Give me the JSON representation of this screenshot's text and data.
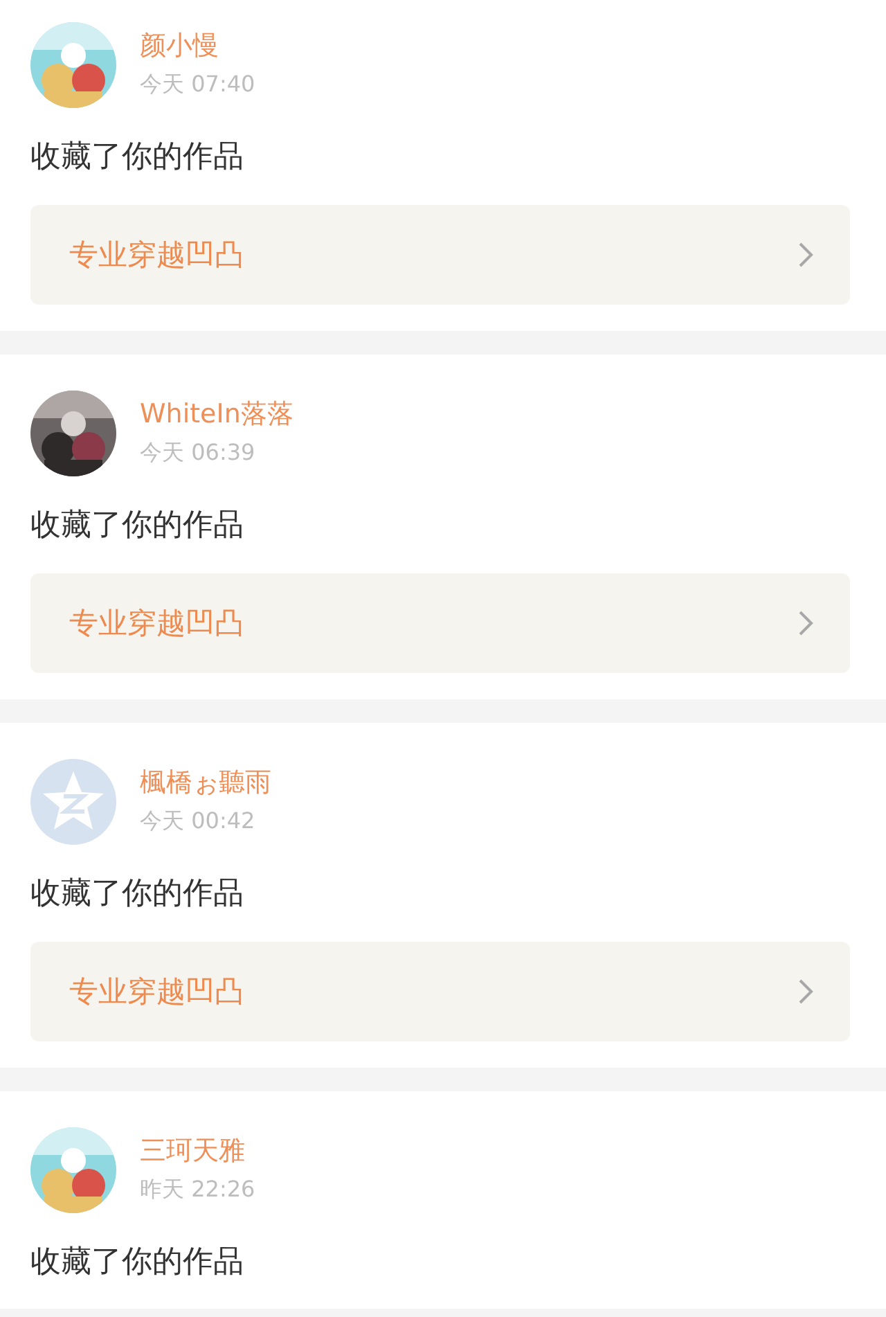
{
  "notifications": [
    {
      "name": "颜小慢",
      "time": "今天 07:40",
      "action": "收藏了你的作品",
      "work": "专业穿越凹凸"
    },
    {
      "name": "WhiteIn落落",
      "time": "今天 06:39",
      "action": "收藏了你的作品",
      "work": "专业穿越凹凸"
    },
    {
      "avatar": {
        "kind": "default"
      },
      "name": "楓橋ぉ聽雨",
      "time": "今天 00:42",
      "action": "收藏了你的作品",
      "work": "专业穿越凹凸"
    },
    {
      "name": "三珂天雅",
      "time": "昨天 22:26",
      "action": "收藏了你的作品"
    }
  ]
}
